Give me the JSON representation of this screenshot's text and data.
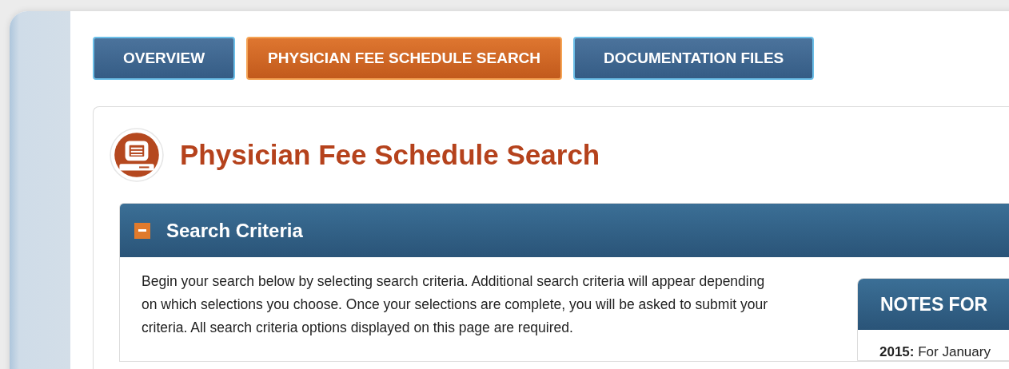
{
  "tabs": [
    {
      "label": "OVERVIEW",
      "selected": false
    },
    {
      "label": "PHYSICIAN FEE SCHEDULE SEARCH",
      "selected": true
    },
    {
      "label": "DOCUMENTATION FILES",
      "selected": false
    }
  ],
  "page_title": "Physician Fee Schedule Search",
  "search_criteria": {
    "title": "Search Criteria",
    "intro": "Begin your search below by selecting search criteria. Additional search criteria will appear depending on which selections you choose. Once your selections are complete, you will be asked to submit your criteria. All search criteria options displayed on this page are required."
  },
  "notes": {
    "title": "NOTES FOR",
    "items": [
      "**2015:** For January"
    ]
  }
}
